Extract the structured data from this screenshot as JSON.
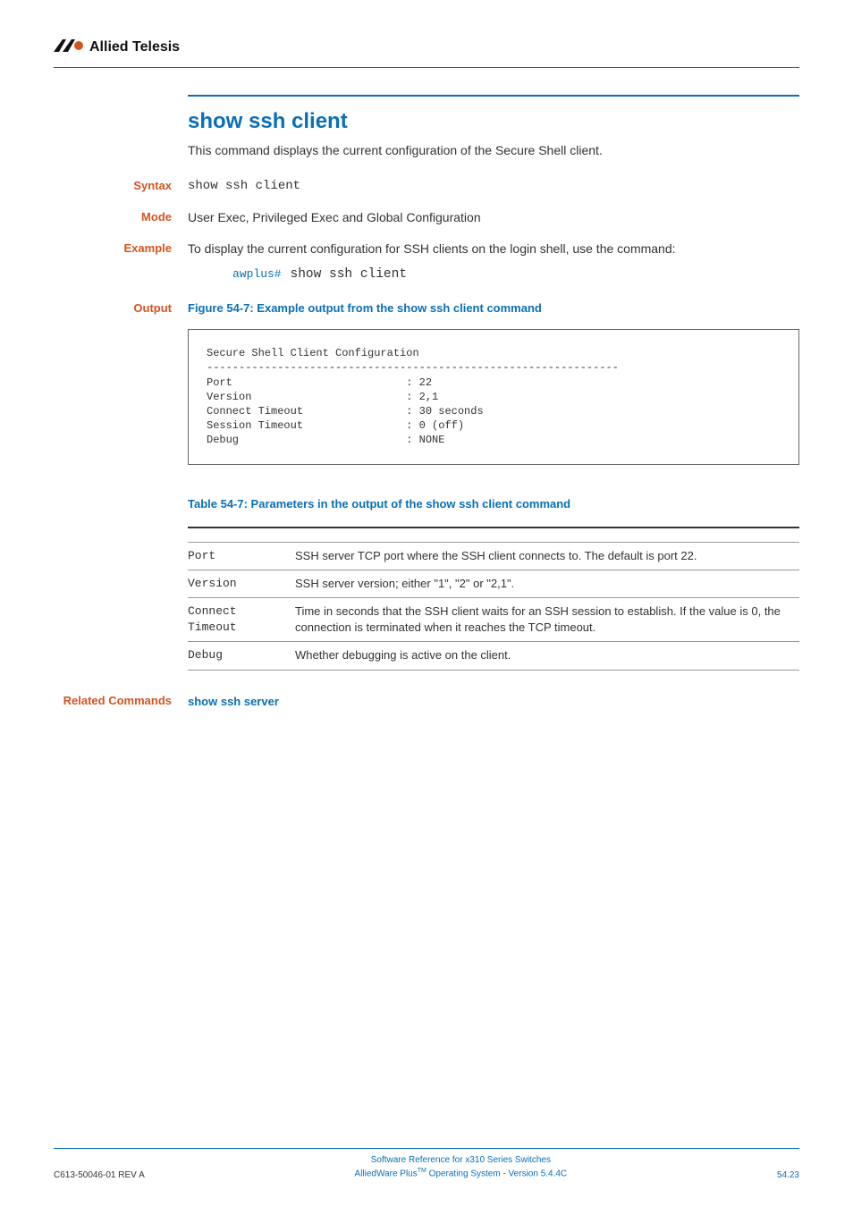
{
  "header": {
    "brand": "Allied Telesis"
  },
  "cmd": {
    "title": "show ssh client",
    "intro": "This command displays the current configuration of the Secure Shell client."
  },
  "labels": {
    "syntax": "Syntax",
    "mode": "Mode",
    "example": "Example",
    "output": "Output",
    "related": "Related Commands"
  },
  "syntax": {
    "text": "show ssh client"
  },
  "mode": {
    "text": "User Exec, Privileged Exec and Global Configuration"
  },
  "example": {
    "text": "To display the current configuration for SSH clients on the login shell, use the command:",
    "prompt": "awplus#",
    "cmd": "show ssh client"
  },
  "output": {
    "caption": "Figure 54-7: Example output from the show ssh client command",
    "box": "Secure Shell Client Configuration\n----------------------------------------------------------------\nPort                           : 22\nVersion                        : 2,1\nConnect Timeout                : 30 seconds\nSession Timeout                : 0 (off)\nDebug                          : NONE"
  },
  "table": {
    "caption": "Table 54-7: Parameters in the output of the show ssh client command",
    "rows": [
      {
        "param": "Port",
        "desc": "SSH server TCP port where the SSH client connects to. The default is port 22."
      },
      {
        "param": "Version",
        "desc": "SSH server version; either \"1\", \"2\" or \"2,1\"."
      },
      {
        "param": "Connect\nTimeout",
        "desc": "Time in seconds that the SSH client waits for an SSH session to establish. If the value is 0, the connection is terminated when it reaches the TCP timeout."
      },
      {
        "param": "Debug",
        "desc": "Whether debugging is active on the client."
      }
    ]
  },
  "related": {
    "link": "show ssh server"
  },
  "footer": {
    "left": "C613-50046-01 REV A",
    "center1": "Software Reference for x310 Series Switches",
    "center2a": "AlliedWare Plus",
    "center2sup": "TM",
    "center2b": " Operating System - Version 5.4.4C",
    "right": "54.23"
  }
}
